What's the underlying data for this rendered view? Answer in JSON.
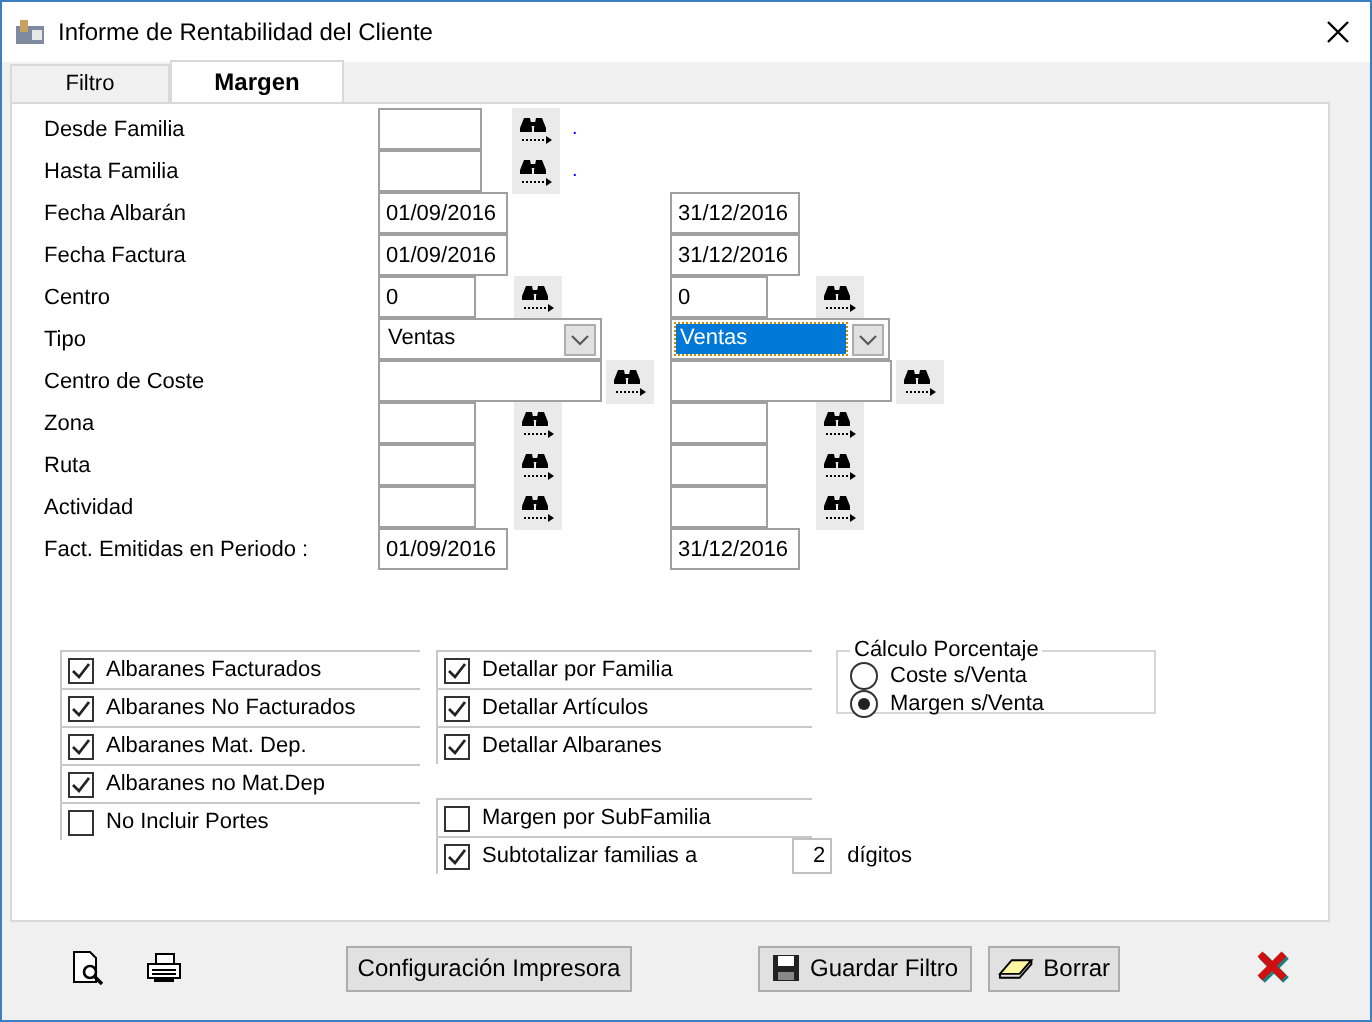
{
  "window": {
    "title": "Informe de Rentabilidad del Cliente"
  },
  "tabs": [
    {
      "label": "Filtro",
      "selected": false
    },
    {
      "label": "Margen",
      "selected": true
    }
  ],
  "filters": [
    {
      "label": "Desde Familia",
      "kind": "family",
      "mark": "."
    },
    {
      "label": "Hasta Familia",
      "kind": "family",
      "mark": "."
    },
    {
      "label": "Fecha Albarán",
      "kind": "date",
      "from": "01/09/2016",
      "to": "31/12/2016"
    },
    {
      "label": "Fecha Factura",
      "kind": "date",
      "from": "01/09/2016",
      "to": "31/12/2016"
    },
    {
      "label": "Centro",
      "kind": "lookup",
      "from": "0",
      "to": "0"
    },
    {
      "label": "Tipo",
      "kind": "combo",
      "from": "Ventas",
      "to": "Ventas",
      "from_focused": false,
      "to_focused": true
    },
    {
      "label": "Centro de Coste",
      "kind": "wide-lookup"
    },
    {
      "label": "Zona",
      "kind": "lookup"
    },
    {
      "label": "Ruta",
      "kind": "lookup"
    },
    {
      "label": "Actividad",
      "kind": "lookup"
    },
    {
      "label": "Fact. Emitidas en Periodo :",
      "kind": "date",
      "from": "01/09/2016",
      "to": "31/12/2016"
    }
  ],
  "left_checks": [
    {
      "label": "Albaranes Facturados",
      "checked": true
    },
    {
      "label": "Albaranes No Facturados",
      "checked": true
    },
    {
      "label": "Albaranes Mat. Dep.",
      "checked": true
    },
    {
      "label": "Albaranes no Mat.Dep",
      "checked": true
    },
    {
      "label": "No Incluir Portes",
      "checked": false
    }
  ],
  "detail_checks": [
    {
      "label": "Detallar por Familia",
      "checked": true
    },
    {
      "label": "Detallar Artículos",
      "checked": true
    },
    {
      "label": "Detallar Albaranes",
      "checked": true
    }
  ],
  "option_checks": [
    {
      "label": "Margen por SubFamilia",
      "checked": false
    },
    {
      "label": "Subtotalizar familias a",
      "checked": true,
      "digits": "2",
      "suffix": "dígitos"
    }
  ],
  "percent_group": {
    "title": "Cálculo Porcentaje",
    "options": [
      {
        "label": "Coste s/Venta",
        "selected": false
      },
      {
        "label": "Margen s/Venta",
        "selected": true
      }
    ]
  },
  "buttons": [
    {
      "label": "Configuración Impresora",
      "kind": "text"
    },
    {
      "label": "Guardar Filtro",
      "kind": "save"
    },
    {
      "label": "Borrar",
      "kind": "erase"
    }
  ]
}
